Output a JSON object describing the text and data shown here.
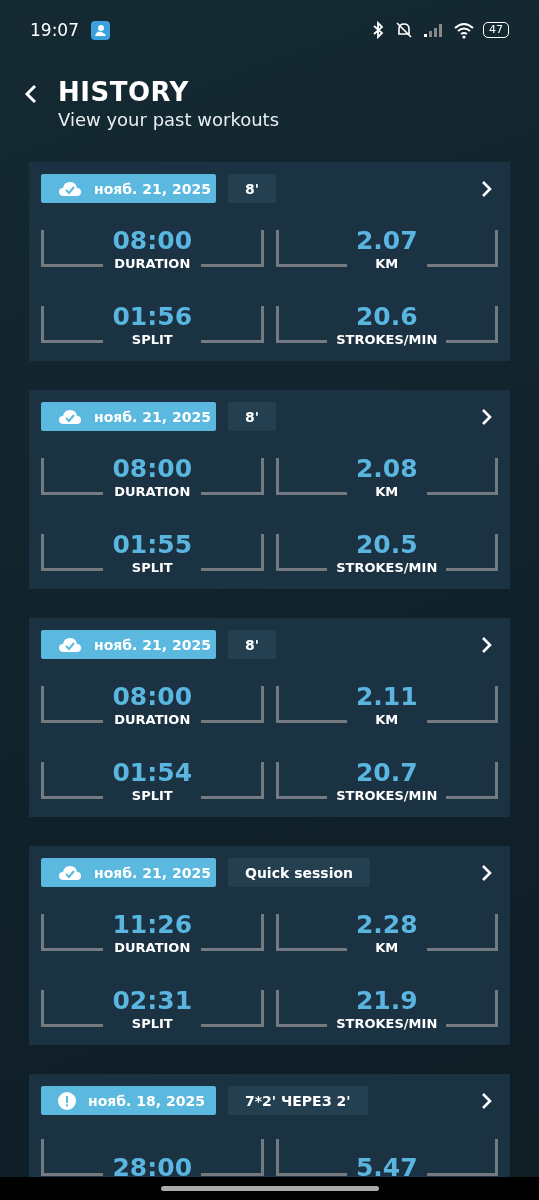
{
  "status_bar": {
    "time": "19:07",
    "battery": "47"
  },
  "header": {
    "title": "HISTORY",
    "subtitle": "View your past workouts"
  },
  "workouts": [
    {
      "synced": true,
      "date": "нояб. 21, 2025",
      "tag": "8'",
      "stats": [
        {
          "value": "08:00",
          "label": "DURATION"
        },
        {
          "value": "2.07",
          "label": "KM"
        },
        {
          "value": "01:56",
          "label": "SPLIT"
        },
        {
          "value": "20.6",
          "label": "STROKES/MIN"
        }
      ]
    },
    {
      "synced": true,
      "date": "нояб. 21, 2025",
      "tag": "8'",
      "stats": [
        {
          "value": "08:00",
          "label": "DURATION"
        },
        {
          "value": "2.08",
          "label": "KM"
        },
        {
          "value": "01:55",
          "label": "SPLIT"
        },
        {
          "value": "20.5",
          "label": "STROKES/MIN"
        }
      ]
    },
    {
      "synced": true,
      "date": "нояб. 21, 2025",
      "tag": "8'",
      "stats": [
        {
          "value": "08:00",
          "label": "DURATION"
        },
        {
          "value": "2.11",
          "label": "KM"
        },
        {
          "value": "01:54",
          "label": "SPLIT"
        },
        {
          "value": "20.7",
          "label": "STROKES/MIN"
        }
      ]
    },
    {
      "synced": true,
      "date": "нояб. 21, 2025",
      "tag": "Quick session",
      "stats": [
        {
          "value": "11:26",
          "label": "DURATION"
        },
        {
          "value": "2.28",
          "label": "KM"
        },
        {
          "value": "02:31",
          "label": "SPLIT"
        },
        {
          "value": "21.9",
          "label": "STROKES/MIN"
        }
      ]
    },
    {
      "synced": false,
      "date": "нояб. 18, 2025",
      "tag": "7*2' ЧЕРЕЗ 2'",
      "stats": [
        {
          "value": "28:00"
        },
        {
          "value": "5.47"
        }
      ]
    }
  ]
}
